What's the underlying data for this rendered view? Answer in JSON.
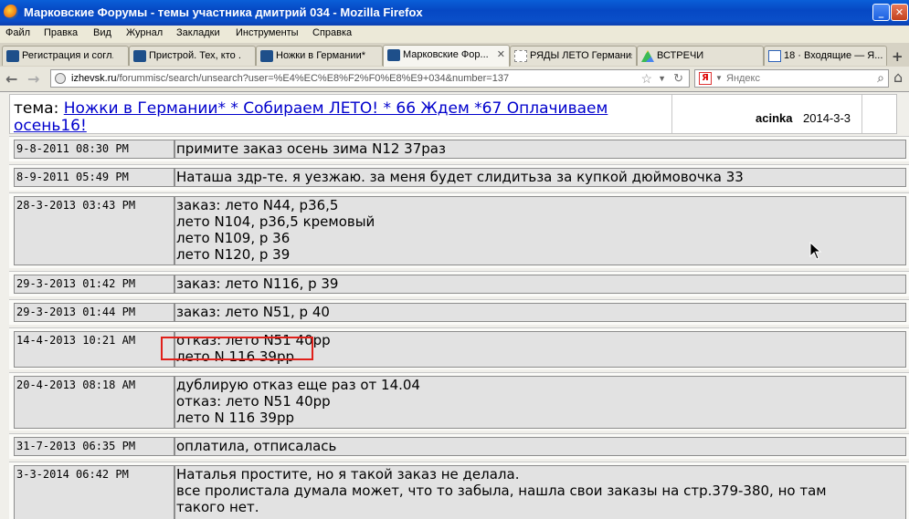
{
  "window": {
    "title": "Марковские Форумы - темы участника дмитрий 034 - Mozilla Firefox"
  },
  "menu": [
    "Файл",
    "Правка",
    "Вид",
    "Журнал",
    "Закладки",
    "Инструменты",
    "Справка"
  ],
  "tabs": [
    {
      "label": "Регистрация и согл...",
      "icon": "pen-icon"
    },
    {
      "label": "Пристрой. Тех, кто ...",
      "icon": "pen-icon"
    },
    {
      "label": "Ножки в Германии* ...",
      "icon": "pen-icon"
    },
    {
      "label": "Марковские Фор...",
      "icon": "pen-icon",
      "active": true
    },
    {
      "label": "РЯДЫ ЛЕТО Германия",
      "icon": "doc-icon"
    },
    {
      "label": "ВСТРЕЧИ",
      "icon": "drive-icon"
    },
    {
      "label": "18 · Входящие — Я...",
      "icon": "mail-icon"
    }
  ],
  "nav": {
    "url_domain": "izhevsk.ru",
    "url_path": "/forummisc/search/unsearch?user=%E4%EC%E8%F2%F0%E8%E9+034&number=137",
    "search_placeholder": "Яндекс"
  },
  "topic": {
    "prefix": "тема: ",
    "title": "Ножки в Германии* * Собираем ЛЕТО! * 66 Ждем *67 Оплачиваем осень16!",
    "author": "acinka",
    "date": "2014-3-3"
  },
  "posts": [
    {
      "date": "9-8-2011 08:30 PM",
      "lines": [
        "примите заказ осень зима N12 37раз"
      ]
    },
    {
      "date": "8-9-2011 05:49 PM",
      "lines": [
        "Наташа здр-те. я уезжаю. за меня будет слидитьза за купкой дюймовочка 33"
      ]
    },
    {
      "date": "28-3-2013 03:43 PM",
      "lines": [
        "заказ: лето N44, р36,5",
        "лето N104, р36,5 кремовый",
        "лето N109, р 36",
        "лето N120, р 39"
      ]
    },
    {
      "date": "29-3-2013 01:42 PM",
      "lines": [
        "заказ: лето N116, р 39"
      ]
    },
    {
      "date": "29-3-2013 01:44 PM",
      "lines": [
        "заказ: лето N51, р 40"
      ]
    },
    {
      "date": "14-4-2013 10:21 AM",
      "lines": [
        "отказ: лето N51 40рр",
        "лето N 116 39рр"
      ]
    },
    {
      "date": "20-4-2013 08:18 AM",
      "lines": [
        "дублирую отказ еще раз от 14.04",
        "отказ: лето N51 40рр",
        "лето N 116 39рр"
      ]
    },
    {
      "date": "31-7-2013 06:35 PM",
      "lines": [
        "оплатила, отписалась"
      ]
    },
    {
      "date": "3-3-2014 06:42 PM",
      "lines": [
        "Наталья простите, но я такой заказ не делала.",
        "все пролистала думала может, что то забыла, нашла свои заказы на стр.379-380, но там",
        "такого нет."
      ]
    }
  ]
}
